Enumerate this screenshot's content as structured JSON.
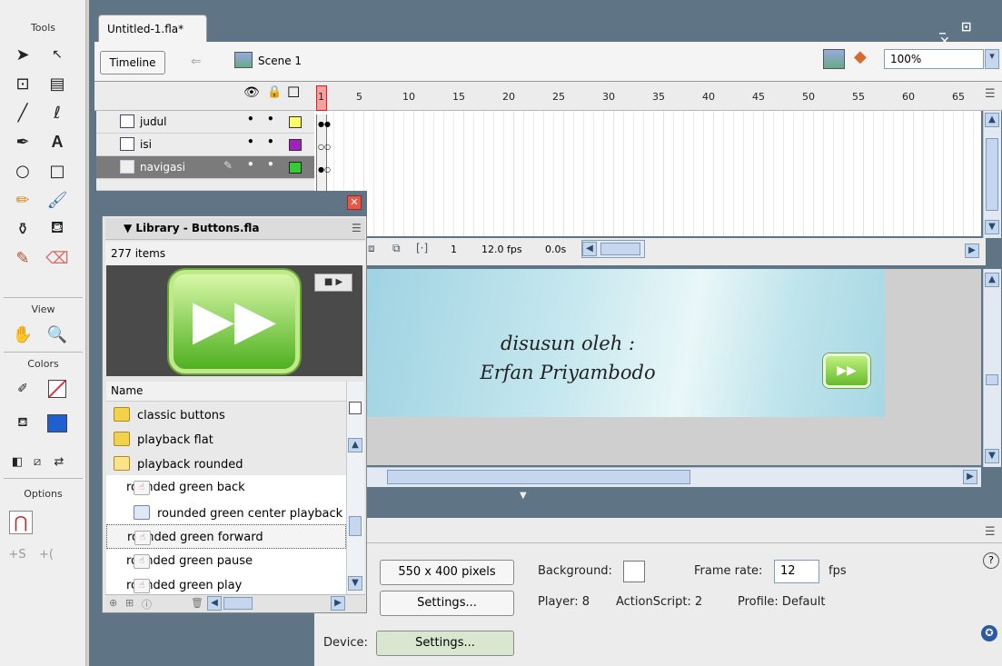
{
  "tools": {
    "title": "Tools",
    "view_title": "View",
    "colors_title": "Colors",
    "options_title": "Options"
  },
  "document": {
    "tab_title": "Untitled-1.fla*",
    "window_controls": "_ ⊡ ✕"
  },
  "edit_bar": {
    "timeline_button": "Timeline",
    "back_arrow": "⇐",
    "scene_label": "Scene 1",
    "zoom_value": "100%",
    "zoom_dropdown": "▾"
  },
  "timeline": {
    "frame_numbers": [
      "1",
      "5",
      "10",
      "15",
      "20",
      "25",
      "30",
      "35",
      "40",
      "45",
      "50",
      "55",
      "60",
      "65"
    ],
    "header_icons": {
      "eye": "👁",
      "lock": "🔒",
      "outline": "☐"
    },
    "layers": [
      {
        "name": "judul",
        "color": "#ffff66",
        "selected": false
      },
      {
        "name": "isi",
        "color": "#a020c0",
        "selected": false
      },
      {
        "name": "navigasi",
        "color": "#33cc33",
        "selected": true
      }
    ],
    "status": {
      "current_frame": "1",
      "fps": "12.0 fps",
      "time": "0.0s"
    }
  },
  "stage": {
    "line1": "disusun oleh :",
    "line2": "Erfan Priyambodo",
    "button_glyph": "▶▶"
  },
  "library": {
    "title": "▼ Library - Buttons.fla",
    "item_count": "277 items",
    "column_name": "Name",
    "preview_glyph": "▶▶",
    "preview_play": "■ ▶",
    "items": [
      {
        "name": "classic buttons",
        "type": "folder"
      },
      {
        "name": "playback flat",
        "type": "folder"
      },
      {
        "name": "playback rounded",
        "type": "folder"
      },
      {
        "name": "rounded green back",
        "type": "button"
      },
      {
        "name": "rounded green center playback",
        "type": "graphic"
      },
      {
        "name": "rounded green forward",
        "type": "button"
      },
      {
        "name": "rounded green pause",
        "type": "button"
      },
      {
        "name": "rounded green play",
        "type": "button"
      }
    ]
  },
  "properties": {
    "size_button": "550 x 400 pixels",
    "background_label": "Background:",
    "frame_rate_label": "Frame rate:",
    "frame_rate_value": "12",
    "fps_unit": "fps",
    "settings_button": "Settings...",
    "player_label": "Player: 8",
    "actionscript_label": "ActionScript: 2",
    "profile_label": "Profile: Default",
    "device_label": "Device:",
    "device_settings_button": "Settings...",
    "help_icon": "?",
    "accessibility_icon": "✪"
  }
}
